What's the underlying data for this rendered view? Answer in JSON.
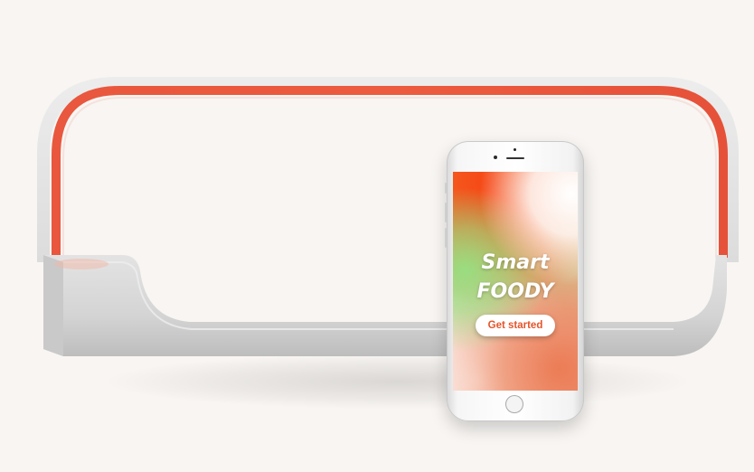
{
  "app": {
    "title_line1": "Smart",
    "title_line2": "FOODY",
    "cta_label": "Get started"
  },
  "colors": {
    "background": "#f8f5f2",
    "device_glow": "#e5533a",
    "device_body": "#d6d6d6",
    "cta_text": "#e5542a",
    "screen_accent_orange": "#f5461a",
    "screen_accent_green": "#96e182"
  },
  "icons": {
    "home": "home-button-icon",
    "camera": "front-camera-icon",
    "speaker": "earpiece-speaker-icon"
  }
}
